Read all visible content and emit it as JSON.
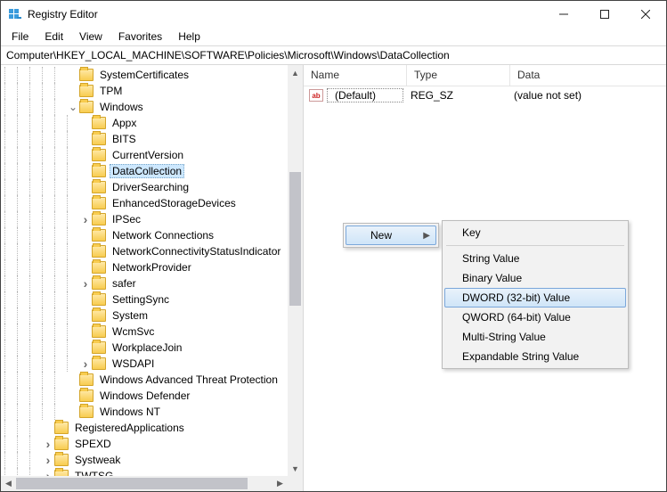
{
  "window": {
    "title": "Registry Editor"
  },
  "menubar": [
    "File",
    "Edit",
    "View",
    "Favorites",
    "Help"
  ],
  "address": "Computer\\HKEY_LOCAL_MACHINE\\SOFTWARE\\Policies\\Microsoft\\Windows\\DataCollection",
  "tree": {
    "items": [
      {
        "indent": 5,
        "expander": "",
        "label": "SystemCertificates"
      },
      {
        "indent": 5,
        "expander": "",
        "label": "TPM"
      },
      {
        "indent": 5,
        "expander": "v",
        "label": "Windows"
      },
      {
        "indent": 6,
        "expander": "",
        "label": "Appx"
      },
      {
        "indent": 6,
        "expander": "",
        "label": "BITS"
      },
      {
        "indent": 6,
        "expander": "",
        "label": "CurrentVersion"
      },
      {
        "indent": 6,
        "expander": "",
        "label": "DataCollection",
        "selected": true
      },
      {
        "indent": 6,
        "expander": "",
        "label": "DriverSearching"
      },
      {
        "indent": 6,
        "expander": "",
        "label": "EnhancedStorageDevices"
      },
      {
        "indent": 6,
        "expander": ">",
        "label": "IPSec"
      },
      {
        "indent": 6,
        "expander": "",
        "label": "Network Connections"
      },
      {
        "indent": 6,
        "expander": "",
        "label": "NetworkConnectivityStatusIndicator"
      },
      {
        "indent": 6,
        "expander": "",
        "label": "NetworkProvider"
      },
      {
        "indent": 6,
        "expander": ">",
        "label": "safer"
      },
      {
        "indent": 6,
        "expander": "",
        "label": "SettingSync"
      },
      {
        "indent": 6,
        "expander": "",
        "label": "System"
      },
      {
        "indent": 6,
        "expander": "",
        "label": "WcmSvc"
      },
      {
        "indent": 6,
        "expander": "",
        "label": "WorkplaceJoin"
      },
      {
        "indent": 6,
        "expander": ">",
        "label": "WSDAPI"
      },
      {
        "indent": 5,
        "expander": "",
        "label": "Windows Advanced Threat Protection"
      },
      {
        "indent": 5,
        "expander": "",
        "label": "Windows Defender"
      },
      {
        "indent": 5,
        "expander": "",
        "label": "Windows NT"
      },
      {
        "indent": 3,
        "expander": "",
        "label": "RegisteredApplications"
      },
      {
        "indent": 3,
        "expander": ">",
        "label": "SPEXD"
      },
      {
        "indent": 3,
        "expander": ">",
        "label": "Systweak"
      },
      {
        "indent": 3,
        "expander": ">",
        "label": "TWTSG"
      }
    ]
  },
  "list": {
    "columns": {
      "name": "Name",
      "type": "Type",
      "data": "Data"
    },
    "rows": [
      {
        "name": "(Default)",
        "type": "REG_SZ",
        "data": "(value not set)"
      }
    ]
  },
  "context_menu": {
    "primary": {
      "new": "New"
    },
    "submenu": {
      "key": "Key",
      "string": "String Value",
      "binary": "Binary Value",
      "dword": "DWORD (32-bit) Value",
      "qword": "QWORD (64-bit) Value",
      "multi": "Multi-String Value",
      "expand": "Expandable String Value"
    }
  }
}
